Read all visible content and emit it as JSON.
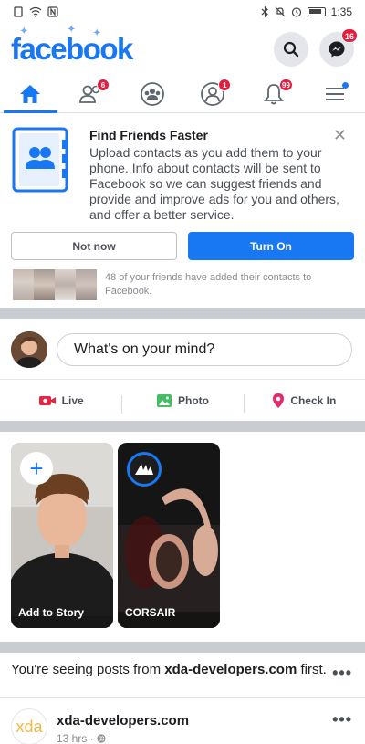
{
  "status_bar": {
    "time": "1:35"
  },
  "header": {
    "logo": "facebook",
    "messenger_badge": "16"
  },
  "nav": {
    "friends_badge": "6",
    "profile_badge": "1",
    "notifications_badge": "99"
  },
  "find_friends": {
    "title": "Find Friends Faster",
    "body": "Upload contacts as you add them to your phone. Info about contacts will be sent to Facebook so we can suggest friends and provide and improve ads for you and others, and offer a better service.",
    "not_now_label": "Not now",
    "turn_on_label": "Turn On",
    "friends_text": "48 of your friends have added their contacts to Facebook."
  },
  "composer": {
    "placeholder": "What's on your mind?"
  },
  "actions": {
    "live": "Live",
    "photo": "Photo",
    "check_in": "Check In"
  },
  "stories": {
    "add_label": "Add to Story",
    "corsair_label": "CORSAIR"
  },
  "notice": {
    "prefix": "You're seeing posts from ",
    "source": "xda-developers.com",
    "suffix": " first."
  },
  "post": {
    "logo_text": "xda",
    "name": "xda-developers.com",
    "time": "13 hrs ·"
  },
  "colors": {
    "brand": "#1877f2",
    "badge": "#e41e3f"
  }
}
